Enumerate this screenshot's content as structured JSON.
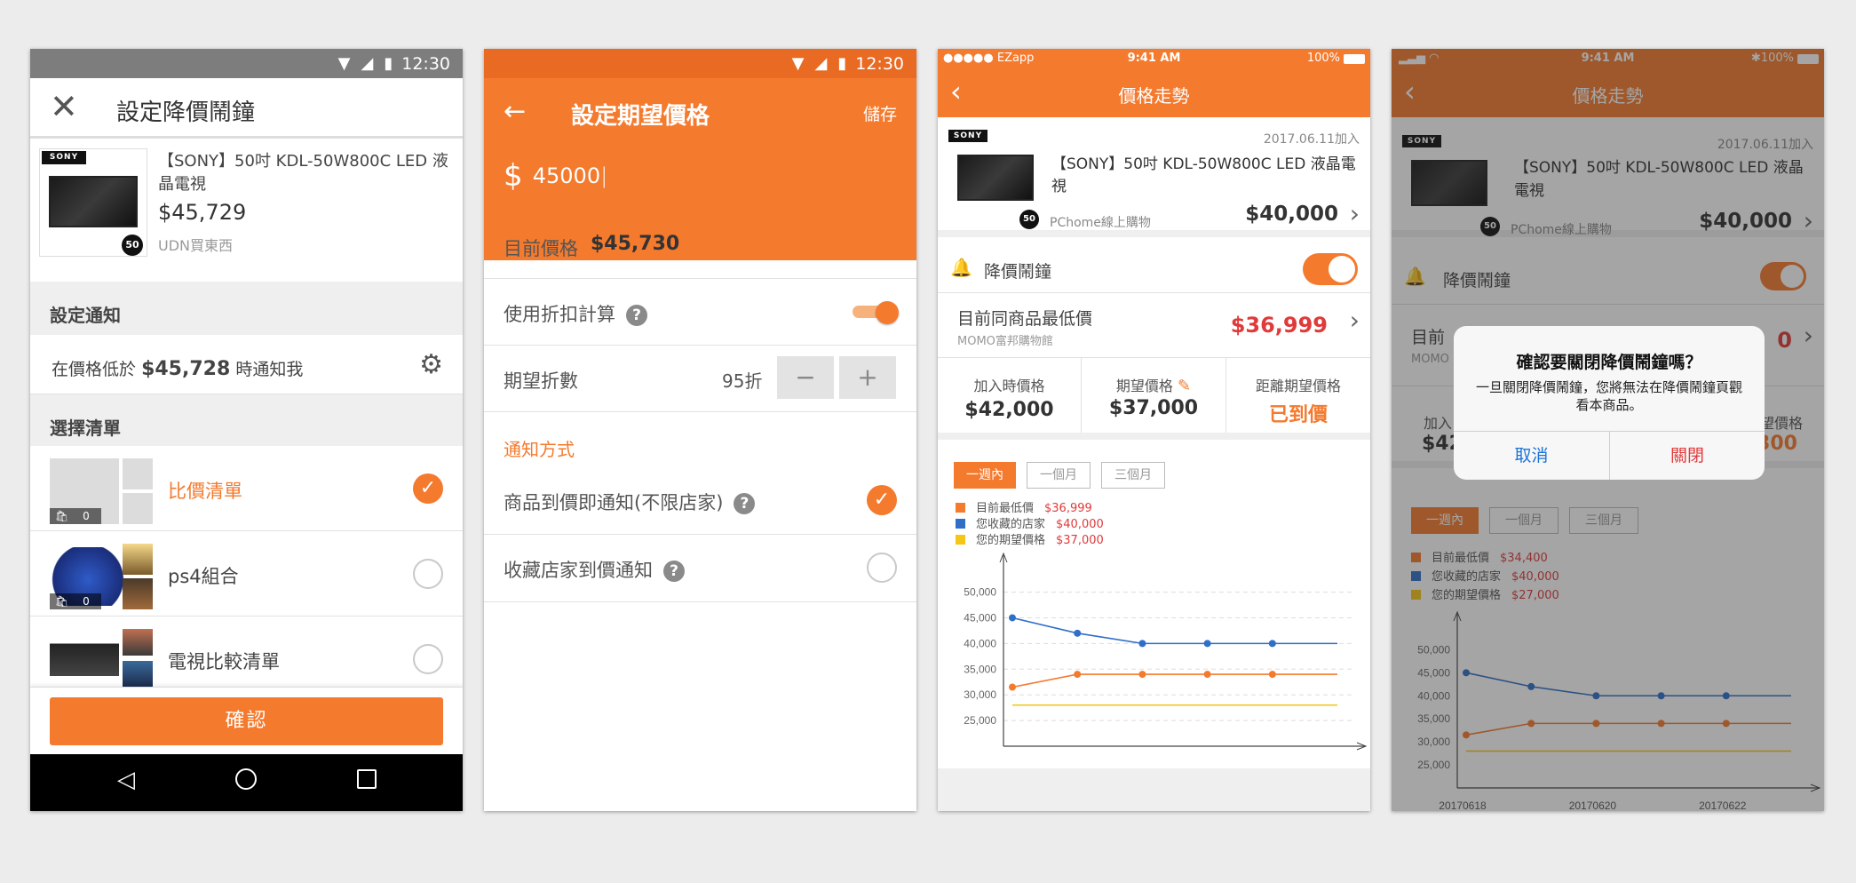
{
  "colors": {
    "accent": "#f47a2e",
    "price_red": "#e03a3a",
    "blue": "#2f6fc8",
    "yellow": "#f5c518"
  },
  "android_status": {
    "time": "12:30"
  },
  "screen1": {
    "title": "設定降價鬧鐘",
    "product": {
      "name": "【SONY】50吋 KDL-50W800C LED 液晶電視",
      "price": "$45,729",
      "store": "UDN買東西",
      "brand": "SONY",
      "badge": "50"
    },
    "notify_header": "設定通知",
    "notify_pre": "在價格低於",
    "notify_price": "$45,728",
    "notify_post": "時通知我",
    "list_header": "選擇清單",
    "lists": [
      {
        "name": "比價清單",
        "count": "0",
        "selected": true
      },
      {
        "name": "ps4組合",
        "count": "0",
        "selected": false
      },
      {
        "name": "電視比較清單",
        "count": "",
        "selected": false
      }
    ],
    "confirm": "確認"
  },
  "screen2": {
    "title": "設定期望價格",
    "save": "儲存",
    "currency": "$",
    "input_value": "45000",
    "current_label": "目前價格",
    "current_price": "$45,730",
    "discount_calc": "使用折扣計算",
    "discount_label": "期望折數",
    "discount_value": "95折",
    "minus": "−",
    "plus": "+",
    "section": "通知方式",
    "opt1": "商品到價即通知(不限店家)",
    "opt2": "收藏店家到價通知"
  },
  "ios_status": {
    "carrier": "●●●●● EZapp",
    "time": "9:41 AM",
    "battery": "100%"
  },
  "screen3": {
    "title": "價格走勢",
    "added": "2017.06.11加入",
    "product_name": "【SONY】50吋 KDL-50W800C LED 液晶電視",
    "store": "PChome線上購物",
    "price": "$40,000",
    "brand": "SONY",
    "badge": "50",
    "alarm_label": "降價鬧鐘",
    "lowest_label": "目前同商品最低價",
    "lowest_store": "MOMO富邦購物館",
    "lowest_price": "$36,999",
    "stat1_label": "加入時價格",
    "stat1_value": "$42,000",
    "stat2_label": "期望價格",
    "stat2_value": "$37,000",
    "stat3_label": "距離期望價格",
    "stat3_value": "已到價",
    "tabs": [
      "一週內",
      "一個月",
      "三個月"
    ],
    "legend": [
      {
        "label": "目前最低價",
        "value": "$36,999",
        "color": "#f47a2e"
      },
      {
        "label": "您收藏的店家",
        "value": "$40,000",
        "color": "#2f6fc8"
      },
      {
        "label": "您的期望價格",
        "value": "$37,000",
        "color": "#f5c518"
      }
    ]
  },
  "screen4": {
    "title": "價格走勢",
    "added": "2017.06.11加入",
    "product_name": "【SONY】50吋 KDL-50W800C LED 液晶電視",
    "store": "PChome線上購物",
    "price": "$40,000",
    "brand": "SONY",
    "badge": "50",
    "alarm_label": "降價鬧鐘",
    "lowest_partial": "目前",
    "lowest_store_partial": "MOMO",
    "lowest_price_partial": "0",
    "stat1_partial": "加入",
    "stat1_value_partial": "$42",
    "stat3_partial": "望價格",
    "stat3_value_partial": "300",
    "tabs": [
      "一週內",
      "一個月",
      "三個月"
    ],
    "legend": [
      {
        "label": "目前最低價",
        "value": "$34,400",
        "color": "#f47a2e"
      },
      {
        "label": "您收藏的店家",
        "value": "$40,000",
        "color": "#2f6fc8"
      },
      {
        "label": "您的期望價格",
        "value": "$27,000",
        "color": "#f5c518"
      }
    ],
    "dialog": {
      "title": "確認要關閉降價鬧鐘嗎？",
      "body": "一旦關閉降價鬧鐘，您將無法在降價鬧鐘頁觀看本商品。",
      "cancel": "取消",
      "confirm": "關閉"
    }
  },
  "chart_data": [
    {
      "type": "line",
      "x": [
        "20170618",
        "20170619",
        "20170620",
        "20170621",
        "20170622",
        "20170623"
      ],
      "xticks": [
        "20170618",
        "20170620",
        "20170622"
      ],
      "yticks": [
        25000,
        30000,
        35000,
        40000,
        45000,
        50000
      ],
      "ylim": [
        20000,
        52000
      ],
      "series": [
        {
          "name": "您收藏的店家",
          "values": [
            45000,
            42000,
            40000,
            40000,
            40000,
            40000
          ]
        },
        {
          "name": "目前最低價",
          "values": [
            31500,
            34000,
            34000,
            34000,
            34000,
            34000
          ]
        },
        {
          "name": "您的期望價格",
          "values": [
            28000,
            28000,
            28000,
            28000,
            28000,
            28000
          ]
        }
      ],
      "grid": true
    },
    {
      "type": "line",
      "x": [
        "20170618",
        "20170619",
        "20170620",
        "20170621",
        "20170622",
        "20170623"
      ],
      "xticks": [
        "20170618",
        "20170620",
        "20170622"
      ],
      "yticks": [
        25000,
        30000,
        35000,
        40000,
        45000,
        50000
      ],
      "ylim": [
        20000,
        52000
      ],
      "series": [
        {
          "name": "您收藏的店家",
          "values": [
            45000,
            42000,
            40000,
            40000,
            40000,
            40000
          ]
        },
        {
          "name": "目前最低價",
          "values": [
            31500,
            34000,
            34000,
            34000,
            34000,
            34000
          ]
        },
        {
          "name": "您的期望價格",
          "values": [
            28000,
            28000,
            28000,
            28000,
            28000,
            28000
          ]
        }
      ],
      "grid": false
    }
  ]
}
